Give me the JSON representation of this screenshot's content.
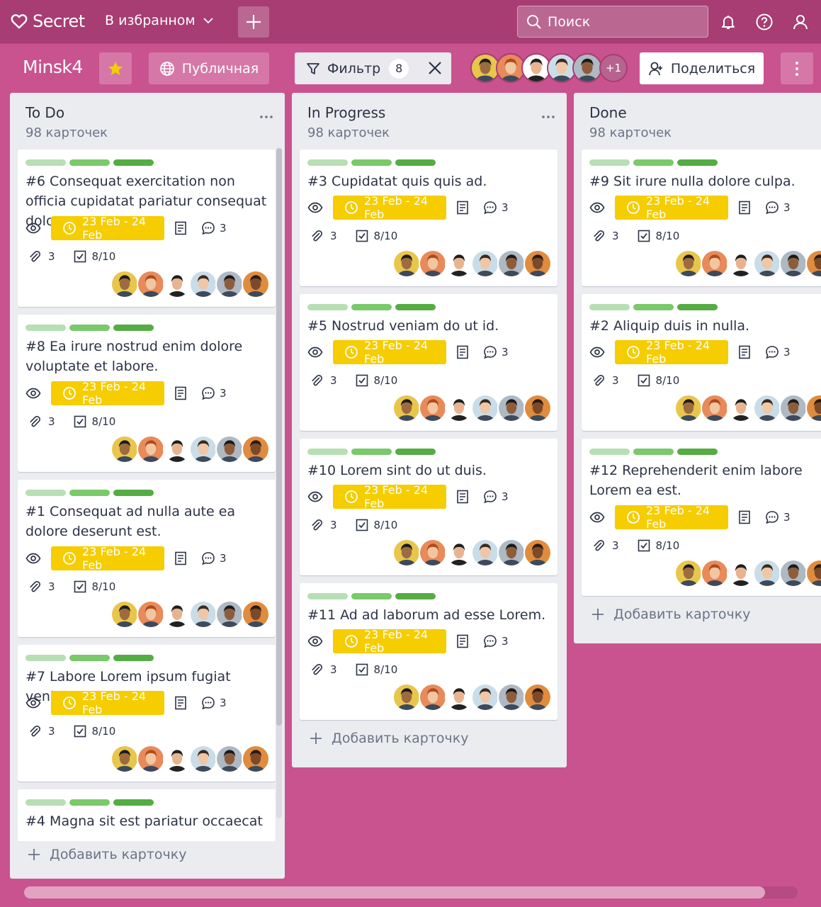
{
  "app": {
    "logo_text": "Secret"
  },
  "navbar": {
    "favorites_label": "В избранном",
    "search_placeholder": "Поиск"
  },
  "board": {
    "title": "Minsk4",
    "visibility_label": "Публичная",
    "filter_label": "Фильтр",
    "filter_count": "8",
    "extra_members": "+1",
    "share_label": "Поделиться"
  },
  "colors": {
    "navbar_bg": "#a73d73",
    "board_bg": "#c9538f",
    "date_badge": "#f5cd00",
    "label_light": "#b7dfb4",
    "label_mid": "#7ac96a",
    "label_dark": "#55ac44",
    "star": "#f5cd00"
  },
  "avatars": [
    "#e8c64c",
    "#e88a5a",
    "#ffffff",
    "#c9dde8",
    "#aeb9c4",
    "#e08c3e"
  ],
  "columns": [
    {
      "title": "To Do",
      "count": "98 карточек",
      "add_label": "Добавить карточку",
      "cards": [
        {
          "title": "#6 Consequat exercitation non officia cupidatat pariatur consequat dolore.",
          "date": "23 Feb - 24 Feb",
          "comments": "3",
          "attachments": "3",
          "checklist": "8/10"
        },
        {
          "title": "#8 Ea irure nostrud enim dolore voluptate et labore.",
          "date": "23 Feb - 24 Feb",
          "comments": "3",
          "attachments": "3",
          "checklist": "8/10"
        },
        {
          "title": "#1 Consequat ad nulla aute ea dolore deserunt est.",
          "date": "23 Feb - 24 Feb",
          "comments": "3",
          "attachments": "3",
          "checklist": "8/10"
        },
        {
          "title": "#7 Labore Lorem ipsum fugiat veniam.",
          "date": "23 Feb - 24 Feb",
          "comments": "3",
          "attachments": "3",
          "checklist": "8/10"
        },
        {
          "title": "#4 Magna sit est pariatur occaecat",
          "date": "",
          "comments": "",
          "attachments": "",
          "checklist": ""
        }
      ]
    },
    {
      "title": "In Progress",
      "count": "98 карточек",
      "add_label": "Добавить карточку",
      "cards": [
        {
          "title": "#3 Cupidatat quis quis ad.",
          "date": "23 Feb - 24 Feb",
          "comments": "3",
          "attachments": "3",
          "checklist": "8/10"
        },
        {
          "title": "#5 Nostrud veniam do ut id.",
          "date": "23 Feb - 24 Feb",
          "comments": "3",
          "attachments": "3",
          "checklist": "8/10"
        },
        {
          "title": "#10 Lorem sint do ut duis.",
          "date": "23 Feb - 24 Feb",
          "comments": "3",
          "attachments": "3",
          "checklist": "8/10"
        },
        {
          "title": "#11 Ad ad laborum ad esse Lorem.",
          "date": "23 Feb - 24 Feb",
          "comments": "3",
          "attachments": "3",
          "checklist": "8/10"
        }
      ]
    },
    {
      "title": "Done",
      "count": "98 карточек",
      "add_label": "Добавить карточку",
      "cards": [
        {
          "title": "#9 Sit irure nulla dolore culpa.",
          "date": "23 Feb - 24 Feb",
          "comments": "3",
          "attachments": "3",
          "checklist": "8/10"
        },
        {
          "title": "#2 Aliquip duis in nulla.",
          "date": "23 Feb - 24 Feb",
          "comments": "3",
          "attachments": "3",
          "checklist": "8/10"
        },
        {
          "title": "#12 Reprehenderit enim labore Lorem ea est.",
          "date": "23 Feb - 24 Feb",
          "comments": "3",
          "attachments": "3",
          "checklist": "8/10"
        }
      ]
    }
  ]
}
